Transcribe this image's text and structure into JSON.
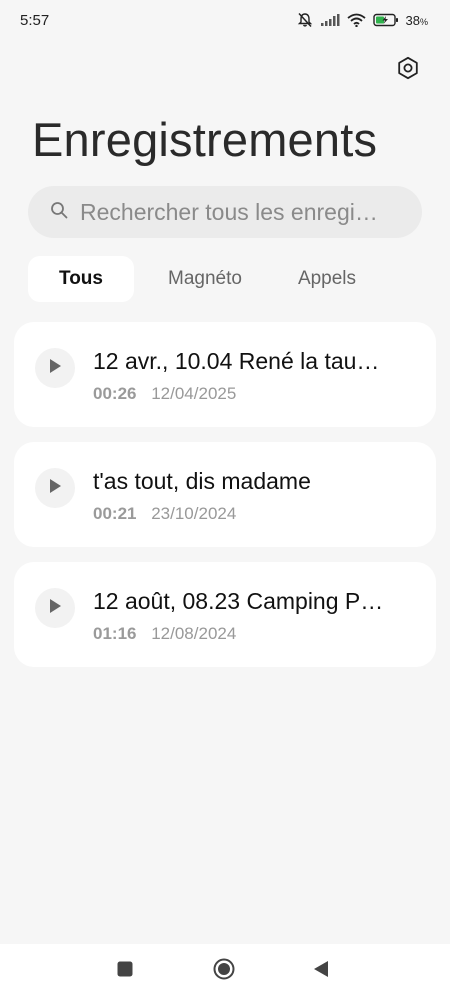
{
  "status_bar": {
    "time": "5:57",
    "battery_percent": "38",
    "battery_unit": "%",
    "icons": [
      "bell-muted-icon",
      "signal-icon",
      "wifi-icon",
      "battery-charging-icon"
    ]
  },
  "header": {
    "settings_icon": "settings-icon",
    "title": "Enregistrements"
  },
  "search": {
    "placeholder": "Rechercher tous les enregi…"
  },
  "tabs": [
    {
      "label": "Tous",
      "active": true
    },
    {
      "label": "Magnéto",
      "active": false
    },
    {
      "label": "Appels",
      "active": false
    }
  ],
  "recordings": [
    {
      "title": "12 avr., 10.04  René la tau…",
      "duration": "00:26",
      "date": "12/04/2025"
    },
    {
      "title": "t'as tout, dis madame",
      "duration": "00:21",
      "date": "23/10/2024"
    },
    {
      "title": "12 août, 08.23 Camping P…",
      "duration": "01:16",
      "date": "12/08/2024"
    }
  ],
  "nav": {
    "icons": [
      "recent-apps-icon",
      "home-icon",
      "back-icon"
    ]
  },
  "colors": {
    "background": "#f6f6f6",
    "card": "#ffffff",
    "search_bg": "#ebebeb",
    "text_primary": "#111111",
    "text_secondary": "#999999"
  }
}
